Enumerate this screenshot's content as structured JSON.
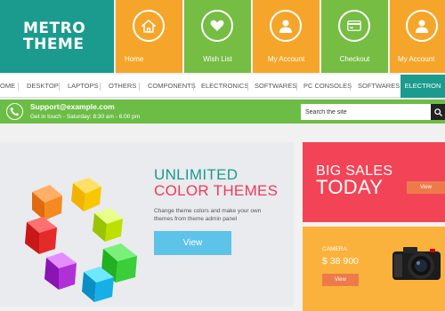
{
  "logo": {
    "line1": "METRO",
    "line2": "THEME"
  },
  "tiles": [
    {
      "label": "Home",
      "icon": "home-icon",
      "color": "#f5a62a"
    },
    {
      "label": "Wish List",
      "icon": "heart-icon",
      "color": "#75bd43"
    },
    {
      "label": "My Account",
      "icon": "user-icon",
      "color": "#f5a62a"
    },
    {
      "label": "Checkout",
      "icon": "credit-card-icon",
      "color": "#75bd43"
    },
    {
      "label": "My Account",
      "icon": "user-icon",
      "color": "#f5a62a"
    }
  ],
  "nav": {
    "items": [
      "OME",
      "DESKTOP",
      "LAPTOPS",
      "OTHERS",
      "COMPONENTS",
      "ELECTRONICS",
      "SOFTWARES",
      "PC CONSOLES",
      "SOFTWARES",
      "ELECTRON"
    ],
    "active_index": 9
  },
  "contact": {
    "email": "Support@example.com",
    "hours": "Get in touch - Saturday: 8:30 am - 6:00 pm",
    "search_placeholder": "Search the site"
  },
  "banner": {
    "title_line1": "UNLIMITED",
    "title_line2": "COLOR THEMES",
    "description": "Change theme colors and make your own themes from theme admin panel",
    "button": "View"
  },
  "promo_sales": {
    "line1": "BIG SALES",
    "line2": "TODAY",
    "button": "View"
  },
  "promo_camera": {
    "label": "CAMERA",
    "price": "$ 38 900",
    "button": "View"
  },
  "colors": {
    "teal": "#1a9b8e",
    "orange": "#f5a62a",
    "green": "#75bd43",
    "red": "#f34457",
    "yellow": "#fbb23c",
    "blue": "#5ec3e8"
  }
}
